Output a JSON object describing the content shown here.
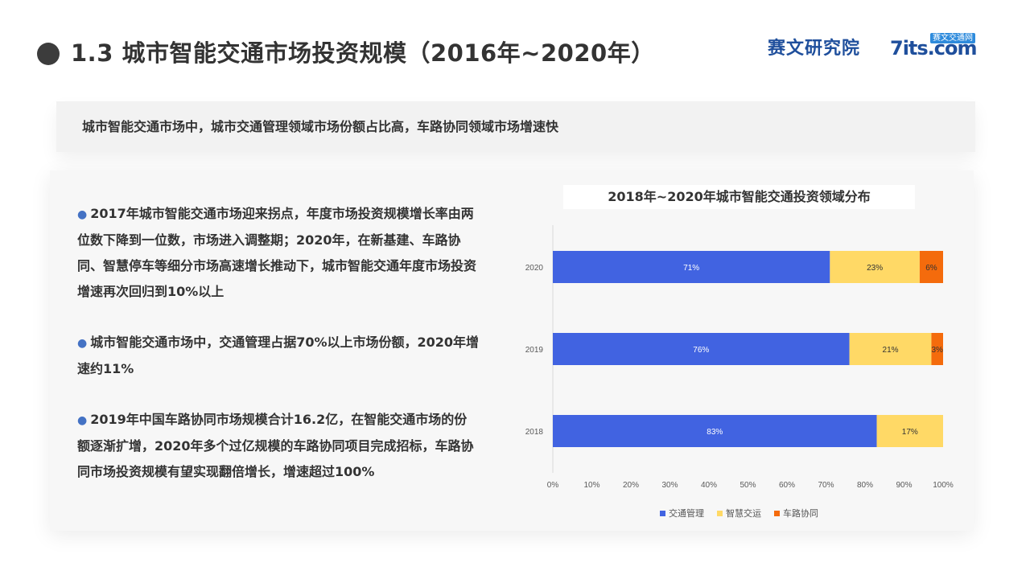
{
  "header": {
    "title": "1.3 城市智能交通市场投资规模（2016年~2020年）",
    "logo_saiwen": "赛文研究院",
    "logo_7its_main": "7its.com",
    "logo_7its_badge": "赛文交通网"
  },
  "subtitle": "城市智能交通市场中，城市交通管理领域市场份额占比高，车路协同领域市场增速快",
  "bullets": [
    "2017年城市智能交通市场迎来拐点，年度市场投资规模增长率由两位数下降到一位数，市场进入调整期；2020年，在新基建、车路协同、智慧停车等细分市场高速增长推动下，城市智能交通年度市场投资增速再次回归到10%以上",
    "城市智能交通市场中，交通管理占据70%以上市场份额，2020年增速约11%",
    "2019年中国车路协同市场规模合计16.2亿，在智能交通市场的份额逐渐扩增，2020年多个过亿规模的车路协同项目完成招标，车路协同市场投资规模有望实现翻倍增长，增速超过100%"
  ],
  "colors": {
    "series1": "#4163e1",
    "series2": "#ffd966",
    "series3": "#f46b0c",
    "bullet_dot": "#4472c4"
  },
  "chart_data": {
    "type": "bar",
    "orientation": "horizontal",
    "stacked": true,
    "title": "2018年~2020年城市智能交通投资领域分布",
    "categories": [
      "2020",
      "2019",
      "2018"
    ],
    "series": [
      {
        "name": "交通管理",
        "values": [
          71,
          76,
          83
        ],
        "labels": [
          "71%",
          "76%",
          "83%"
        ]
      },
      {
        "name": "智慧交运",
        "values": [
          23,
          21,
          17
        ],
        "labels": [
          "23%",
          "21%",
          "17%"
        ]
      },
      {
        "name": "车路协同",
        "values": [
          6,
          3,
          0
        ],
        "labels": [
          "6%",
          "3%",
          ""
        ]
      }
    ],
    "x_ticks": [
      "0%",
      "10%",
      "20%",
      "30%",
      "40%",
      "50%",
      "60%",
      "70%",
      "80%",
      "90%",
      "100%"
    ],
    "xlim": [
      0,
      100
    ],
    "legend_position": "bottom",
    "grid": false
  }
}
